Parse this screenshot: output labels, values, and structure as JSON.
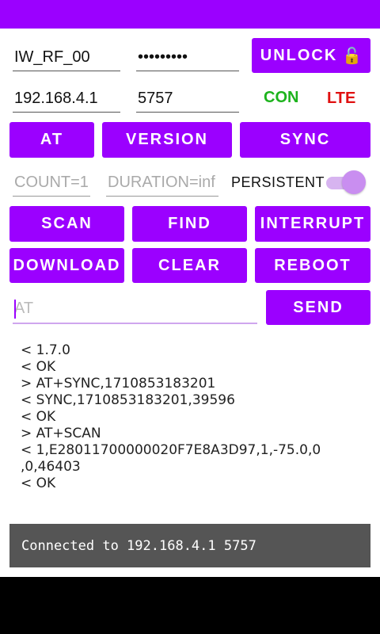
{
  "connection": {
    "ssid": "IW_RF_00",
    "password": "•••••••••",
    "ip": "192.168.4.1",
    "port": "5757",
    "unlock_label": "UNLOCK",
    "lock_icon": "🔓",
    "con_label": "CON",
    "lte_label": "LTE"
  },
  "buttons": {
    "at": "AT",
    "version": "VERSION",
    "sync": "SYNC",
    "scan": "SCAN",
    "find": "FIND",
    "interrupt": "INTERRUPT",
    "download": "DOWNLOAD",
    "clear": "CLEAR",
    "reboot": "REBOOT",
    "send": "SEND"
  },
  "options": {
    "count_placeholder": "COUNT=1",
    "duration_placeholder": "DURATION=inf",
    "persistent_label": "PERSISTENT",
    "persistent_on": true
  },
  "command": {
    "placeholder": "AT"
  },
  "log": [
    "< 1.7.0",
    "< OK",
    "> AT+SYNC,1710853183201",
    "< SYNC,1710853183201,39596",
    "< OK",
    "> AT+SCAN",
    "< 1,E28011700000020F7E8A3D97,1,-75.0,0",
    ",0,46403",
    "< OK"
  ],
  "status_message": "Connected to 192.168.4.1 5757",
  "colors": {
    "accent": "#9b00ff",
    "con": "#1db31d",
    "lte": "#e01010",
    "status_bg": "#555555"
  }
}
